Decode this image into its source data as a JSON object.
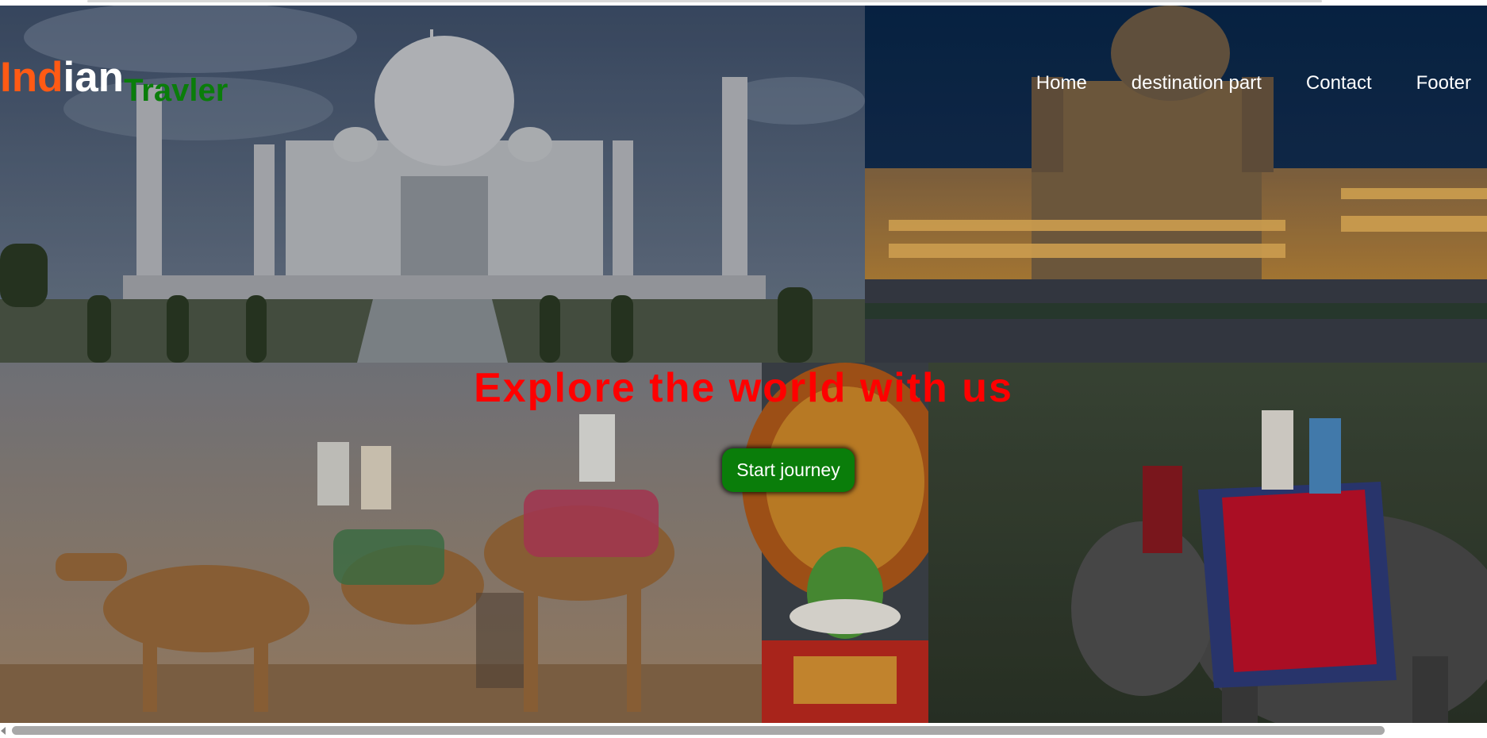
{
  "logo": {
    "part1": "Ind",
    "part2": "ian",
    "part3": "Travler"
  },
  "nav": {
    "items": [
      "Home",
      "destination part",
      "Contact",
      "Footer"
    ]
  },
  "hero": {
    "headline": "Explore the world with us",
    "cta_label": "Start journey"
  },
  "colors": {
    "logo_saffron": "#ff5a14",
    "logo_white": "#ffffff",
    "logo_green": "#0a7d0a",
    "headline": "#ff0000",
    "button_bg": "#0a7d0a"
  },
  "icons": [
    "scroll-left-arrow-icon"
  ]
}
